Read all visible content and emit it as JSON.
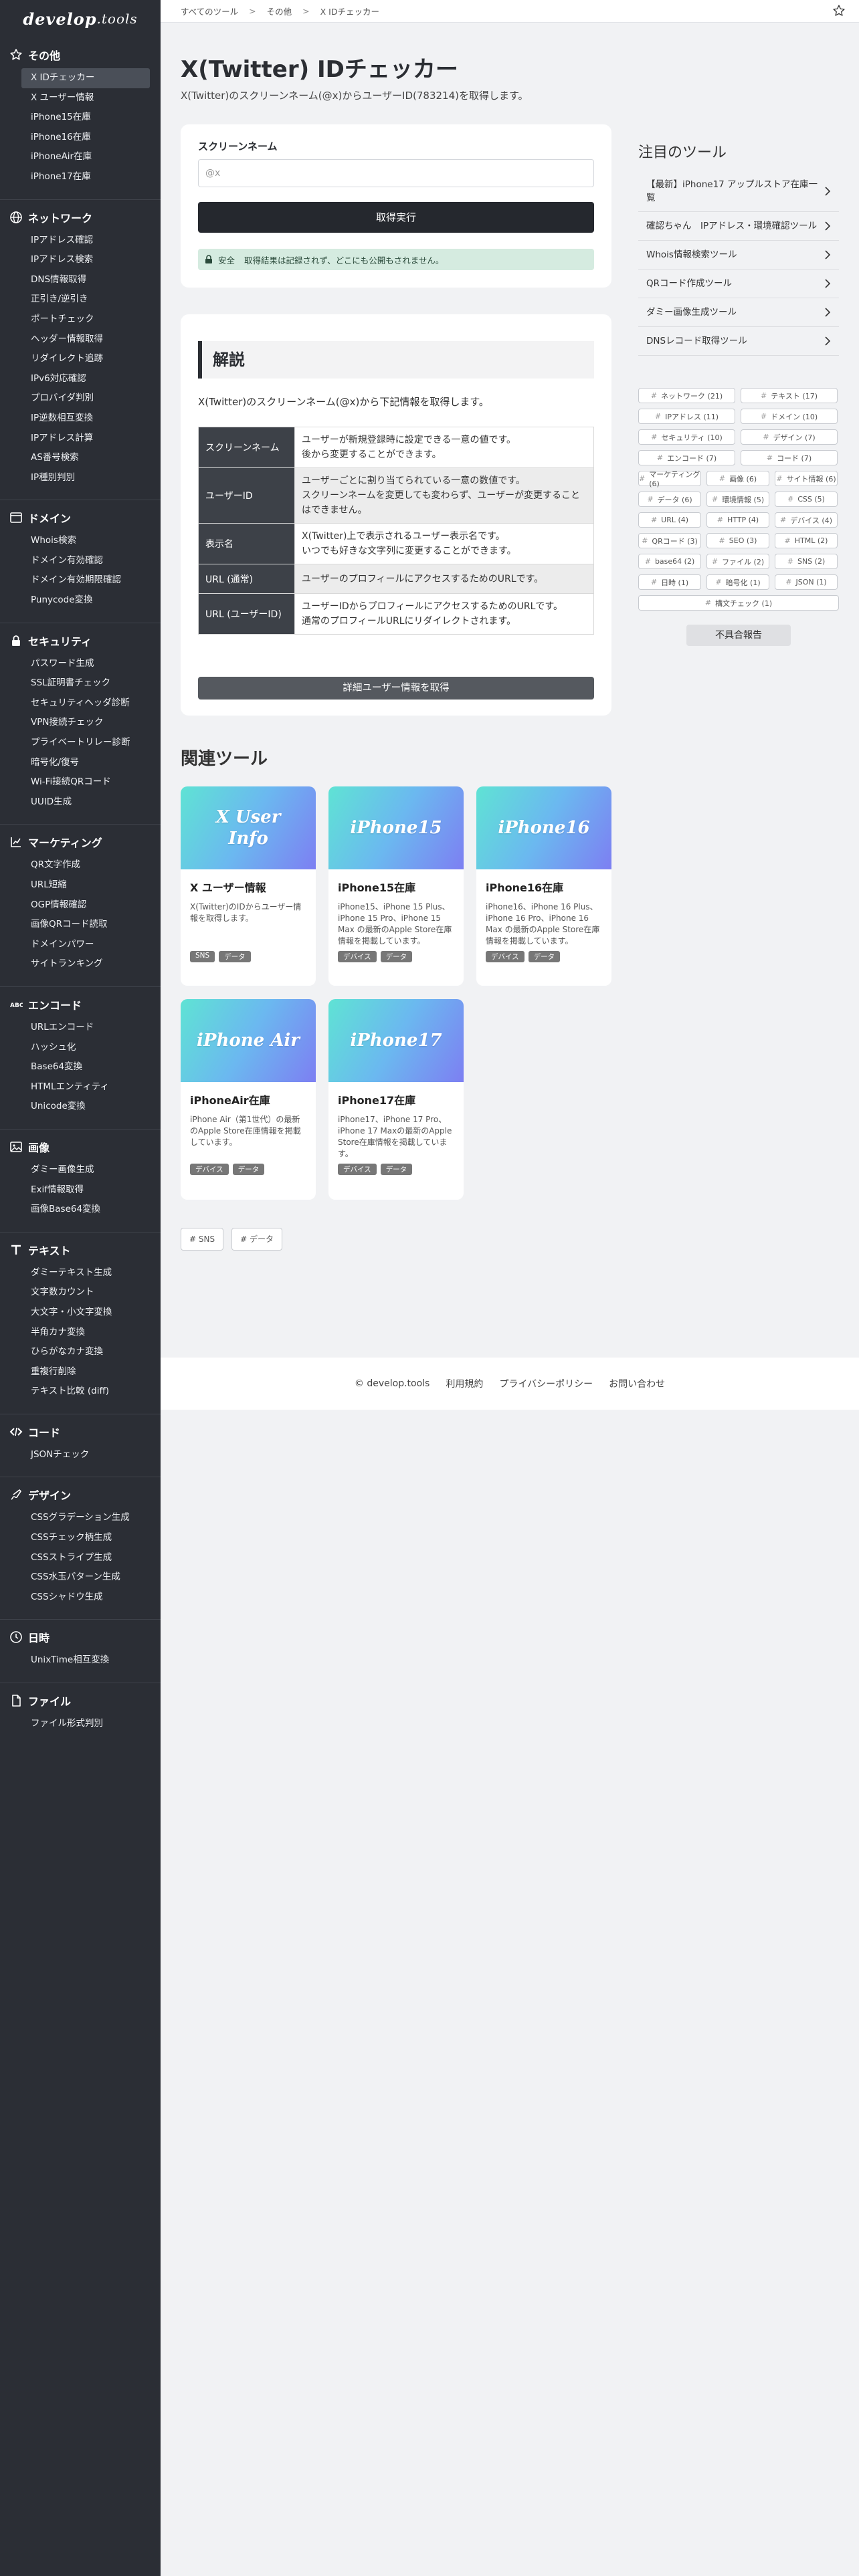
{
  "logo": {
    "main": "develop",
    "suffix": ".tools"
  },
  "sidebar": [
    {
      "title": "その他",
      "icon": "star-icon",
      "items": [
        "X IDチェッカー",
        "X ユーザー情報",
        "iPhone15在庫",
        "iPhone16在庫",
        "iPhoneAir在庫",
        "iPhone17在庫"
      ],
      "active": 0
    },
    {
      "title": "ネットワーク",
      "icon": "globe-icon",
      "items": [
        "IPアドレス確認",
        "IPアドレス検索",
        "DNS情報取得",
        "正引き/逆引き",
        "ポートチェック",
        "ヘッダー情報取得",
        "リダイレクト追跡",
        "IPv6対応確認",
        "プロバイダ判別",
        "IP逆数相互変換",
        "IPアドレス計算",
        "AS番号検索",
        "IP種別判別"
      ]
    },
    {
      "title": "ドメイン",
      "icon": "window-icon",
      "items": [
        "Whois検索",
        "ドメイン有効確認",
        "ドメイン有効期限確認",
        "Punycode変換"
      ]
    },
    {
      "title": "セキュリティ",
      "icon": "lock-icon",
      "items": [
        "パスワード生成",
        "SSL証明書チェック",
        "セキュリティヘッダ診断",
        "VPN接続チェック",
        "プライベートリレー診断",
        "暗号化/復号",
        "Wi-Fi接続QRコード",
        "UUID生成"
      ]
    },
    {
      "title": "マーケティング",
      "icon": "chart-icon",
      "items": [
        "QR文字作成",
        "URL短縮",
        "OGP情報確認",
        "画像QRコード読取",
        "ドメインパワー",
        "サイトランキング"
      ]
    },
    {
      "title": "エンコード",
      "icon": "abc-icon",
      "items": [
        "URLエンコード",
        "ハッシュ化",
        "Base64変換",
        "HTMLエンティティ",
        "Unicode変換"
      ]
    },
    {
      "title": "画像",
      "icon": "image-icon",
      "items": [
        "ダミー画像生成",
        "Exif情報取得",
        "画像Base64変換"
      ]
    },
    {
      "title": "テキスト",
      "icon": "text-icon",
      "items": [
        "ダミーテキスト生成",
        "文字数カウント",
        "大文字・小文字変換",
        "半角カナ変換",
        "ひらがなカナ変換",
        "重複行削除",
        "テキスト比較 (diff)"
      ]
    },
    {
      "title": "コード",
      "icon": "code-icon",
      "items": [
        "JSONチェック"
      ]
    },
    {
      "title": "デザイン",
      "icon": "palette-icon",
      "items": [
        "CSSグラデーション生成",
        "CSSチェック柄生成",
        "CSSストライプ生成",
        "CSS水玉パターン生成",
        "CSSシャドウ生成"
      ]
    },
    {
      "title": "日時",
      "icon": "clock-icon",
      "items": [
        "UnixTime相互変換"
      ]
    },
    {
      "title": "ファイル",
      "icon": "file-icon",
      "items": [
        "ファイル形式判別"
      ]
    }
  ],
  "breadcrumb": [
    "すべてのツール",
    "その他",
    "X IDチェッカー"
  ],
  "page": {
    "title": "X(Twitter) IDチェッカー",
    "desc": "X(Twitter)のスクリーンネーム(@x)からユーザーID(783214)を取得します。"
  },
  "form": {
    "label": "スクリーンネーム",
    "placeholder": "@x",
    "button": "取得実行",
    "notice_tag": "安全",
    "notice": "取得結果は記録されず、どこにも公開もされません。"
  },
  "explanation": {
    "heading": "解説",
    "intro": "X(Twitter)のスクリーンネーム(@x)から下記情報を取得します。",
    "rows": [
      {
        "k": "スクリーンネーム",
        "v": [
          "ユーザーが新規登録時に設定できる一意の値です。",
          "後から変更することができます。"
        ]
      },
      {
        "k": "ユーザーID",
        "v": [
          "ユーザーごとに割り当てられている一意の数値です。",
          "スクリーンネームを変更しても変わらず、ユーザーが変更すること",
          "はできません。"
        ]
      },
      {
        "k": "表示名",
        "v": [
          "X(Twitter)上で表示されるユーザー表示名です。",
          "いつでも好きな文字列に変更することができます。"
        ]
      },
      {
        "k": "URL (通常)",
        "v": [
          "ユーザーのプロフィールにアクセスするためのURLです。"
        ]
      },
      {
        "k": "URL (ユーザーID)",
        "v": [
          "ユーザーIDからプロフィールにアクセスするためのURLです。",
          "通常のプロフィールURLにリダイレクトされます。"
        ]
      }
    ],
    "button": "詳細ユーザー情報を取得"
  },
  "featured": {
    "title": "注目のツール",
    "items": [
      "【最新】iPhone17 アップルストア在庫一覧",
      "確認ちゃん　IPアドレス・環境確認ツール",
      "Whois情報検索ツール",
      "QRコード作成ツール",
      "ダミー画像生成ツール",
      "DNSレコード取得ツール"
    ]
  },
  "tags": [
    {
      "t": "ネットワーク (21)",
      "w": "t2"
    },
    {
      "t": "テキスト (17)",
      "w": "t2"
    },
    {
      "t": "IPアドレス (11)",
      "w": "t2"
    },
    {
      "t": "ドメイン (10)",
      "w": "t2"
    },
    {
      "t": "セキュリティ (10)",
      "w": "t2"
    },
    {
      "t": "デザイン (7)",
      "w": "t2"
    },
    {
      "t": "エンコード (7)",
      "w": "t2"
    },
    {
      "t": "コード (7)",
      "w": "t2"
    },
    {
      "t": "マーケティング (6)",
      "w": "t3"
    },
    {
      "t": "画像 (6)",
      "w": "t3"
    },
    {
      "t": "サイト情報 (6)",
      "w": "t3"
    },
    {
      "t": "データ (6)",
      "w": "t3"
    },
    {
      "t": "環境情報 (5)",
      "w": "t3"
    },
    {
      "t": "CSS (5)",
      "w": "t3"
    },
    {
      "t": "URL (4)",
      "w": "t3"
    },
    {
      "t": "HTTP (4)",
      "w": "t3"
    },
    {
      "t": "デバイス (4)",
      "w": "t3"
    },
    {
      "t": "QRコード (3)",
      "w": "t3"
    },
    {
      "t": "SEO (3)",
      "w": "t3"
    },
    {
      "t": "HTML (2)",
      "w": "t3"
    },
    {
      "t": "base64 (2)",
      "w": "t3"
    },
    {
      "t": "ファイル (2)",
      "w": "t3"
    },
    {
      "t": "SNS (2)",
      "w": "t3"
    },
    {
      "t": "日時 (1)",
      "w": "t3"
    },
    {
      "t": "暗号化 (1)",
      "w": "t3"
    },
    {
      "t": "JSON (1)",
      "w": "t3"
    },
    {
      "t": "構文チェック (1)",
      "w": "tfull"
    }
  ],
  "report": "不具合報告",
  "related": {
    "title": "関連ツール",
    "cards": [
      {
        "banner": [
          "X User",
          "Info"
        ],
        "title": "X ユーザー情報",
        "desc": "X(Twitter)のIDからユーザー情報を取得します。",
        "tags": [
          "SNS",
          "データ"
        ]
      },
      {
        "banner": [
          "iPhone15"
        ],
        "title": "iPhone15在庫",
        "desc": "iPhone15、iPhone 15 Plus、iPhone 15 Pro、iPhone 15 Max の最新のApple Store在庫情報を掲載しています。",
        "tags": [
          "デバイス",
          "データ"
        ]
      },
      {
        "banner": [
          "iPhone16"
        ],
        "title": "iPhone16在庫",
        "desc": "iPhone16、iPhone 16 Plus、iPhone 16 Pro、iPhone 16 Max の最新のApple Store在庫情報を掲載しています。",
        "tags": [
          "デバイス",
          "データ"
        ]
      },
      {
        "banner": [
          "iPhone Air"
        ],
        "title": "iPhoneAir在庫",
        "desc": "iPhone Air（第1世代）の最新のApple Store在庫情報を掲載しています。",
        "tags": [
          "デバイス",
          "データ"
        ]
      },
      {
        "banner": [
          "iPhone17"
        ],
        "title": "iPhone17在庫",
        "desc": "iPhone17、iPhone 17 Pro、iPhone 17 Maxの最新のApple Store在庫情報を掲載しています。",
        "tags": [
          "デバイス",
          "データ"
        ]
      }
    ]
  },
  "bottom_tags": [
    "# SNS",
    "# データ"
  ],
  "footer": [
    "© develop.tools",
    "利用規約",
    "プライバシーポリシー",
    "お問い合わせ"
  ]
}
